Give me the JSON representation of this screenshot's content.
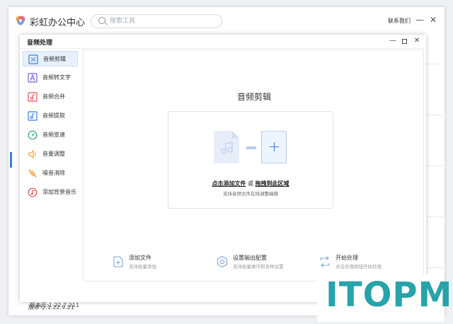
{
  "app": {
    "title": "彩虹办公中心",
    "search_placeholder": "搜索工具",
    "contact": "联系我们",
    "minimize": "—",
    "close": "✕",
    "version": "版本号:1.22.9.21"
  },
  "dialog": {
    "title": "音频处理",
    "minimize": "—",
    "close": "✕",
    "version": "版本号:1.22.7.211",
    "sidebar": [
      {
        "label": "音频剪辑",
        "icon": "audio-cut-icon",
        "color": "#3d7bd9",
        "active": true
      },
      {
        "label": "音频转文字",
        "icon": "audio-to-text-icon",
        "color": "#7a5ad9",
        "active": false
      },
      {
        "label": "音频合并",
        "icon": "audio-merge-icon",
        "color": "#e0524f",
        "active": false
      },
      {
        "label": "音频提取",
        "icon": "audio-extract-icon",
        "color": "#3d7bd9",
        "active": false
      },
      {
        "label": "音频变速",
        "icon": "audio-speed-icon",
        "color": "#2fae6b",
        "active": false
      },
      {
        "label": "音量调整",
        "icon": "volume-icon",
        "color": "#f0a020",
        "active": false
      },
      {
        "label": "噪音消除",
        "icon": "noise-remove-icon",
        "color": "#f08a20",
        "active": false
      },
      {
        "label": "添加背景音乐",
        "icon": "background-music-icon",
        "color": "#e0524f",
        "active": false
      }
    ],
    "main": {
      "title": "音频剪辑",
      "drop_add": "点击添加文件",
      "drop_or": " 或 ",
      "drop_drag": "拖拽到此区域",
      "drop_hint": "支持音频文件在线调整编辑"
    },
    "actions": [
      {
        "title": "添加文件",
        "sub": "支持批量添加",
        "icon": "add-file-icon"
      },
      {
        "title": "设置输出配置",
        "sub": "支持批量操作和各种设置",
        "icon": "settings-icon"
      },
      {
        "title": "开始处理",
        "sub": "点击处理按钮开始处理",
        "icon": "start-process-icon"
      }
    ]
  },
  "watermark": {
    "text": "ITOPM"
  },
  "colors": {
    "accent": "#3d7bd9",
    "watermark": "#27a3a9"
  }
}
